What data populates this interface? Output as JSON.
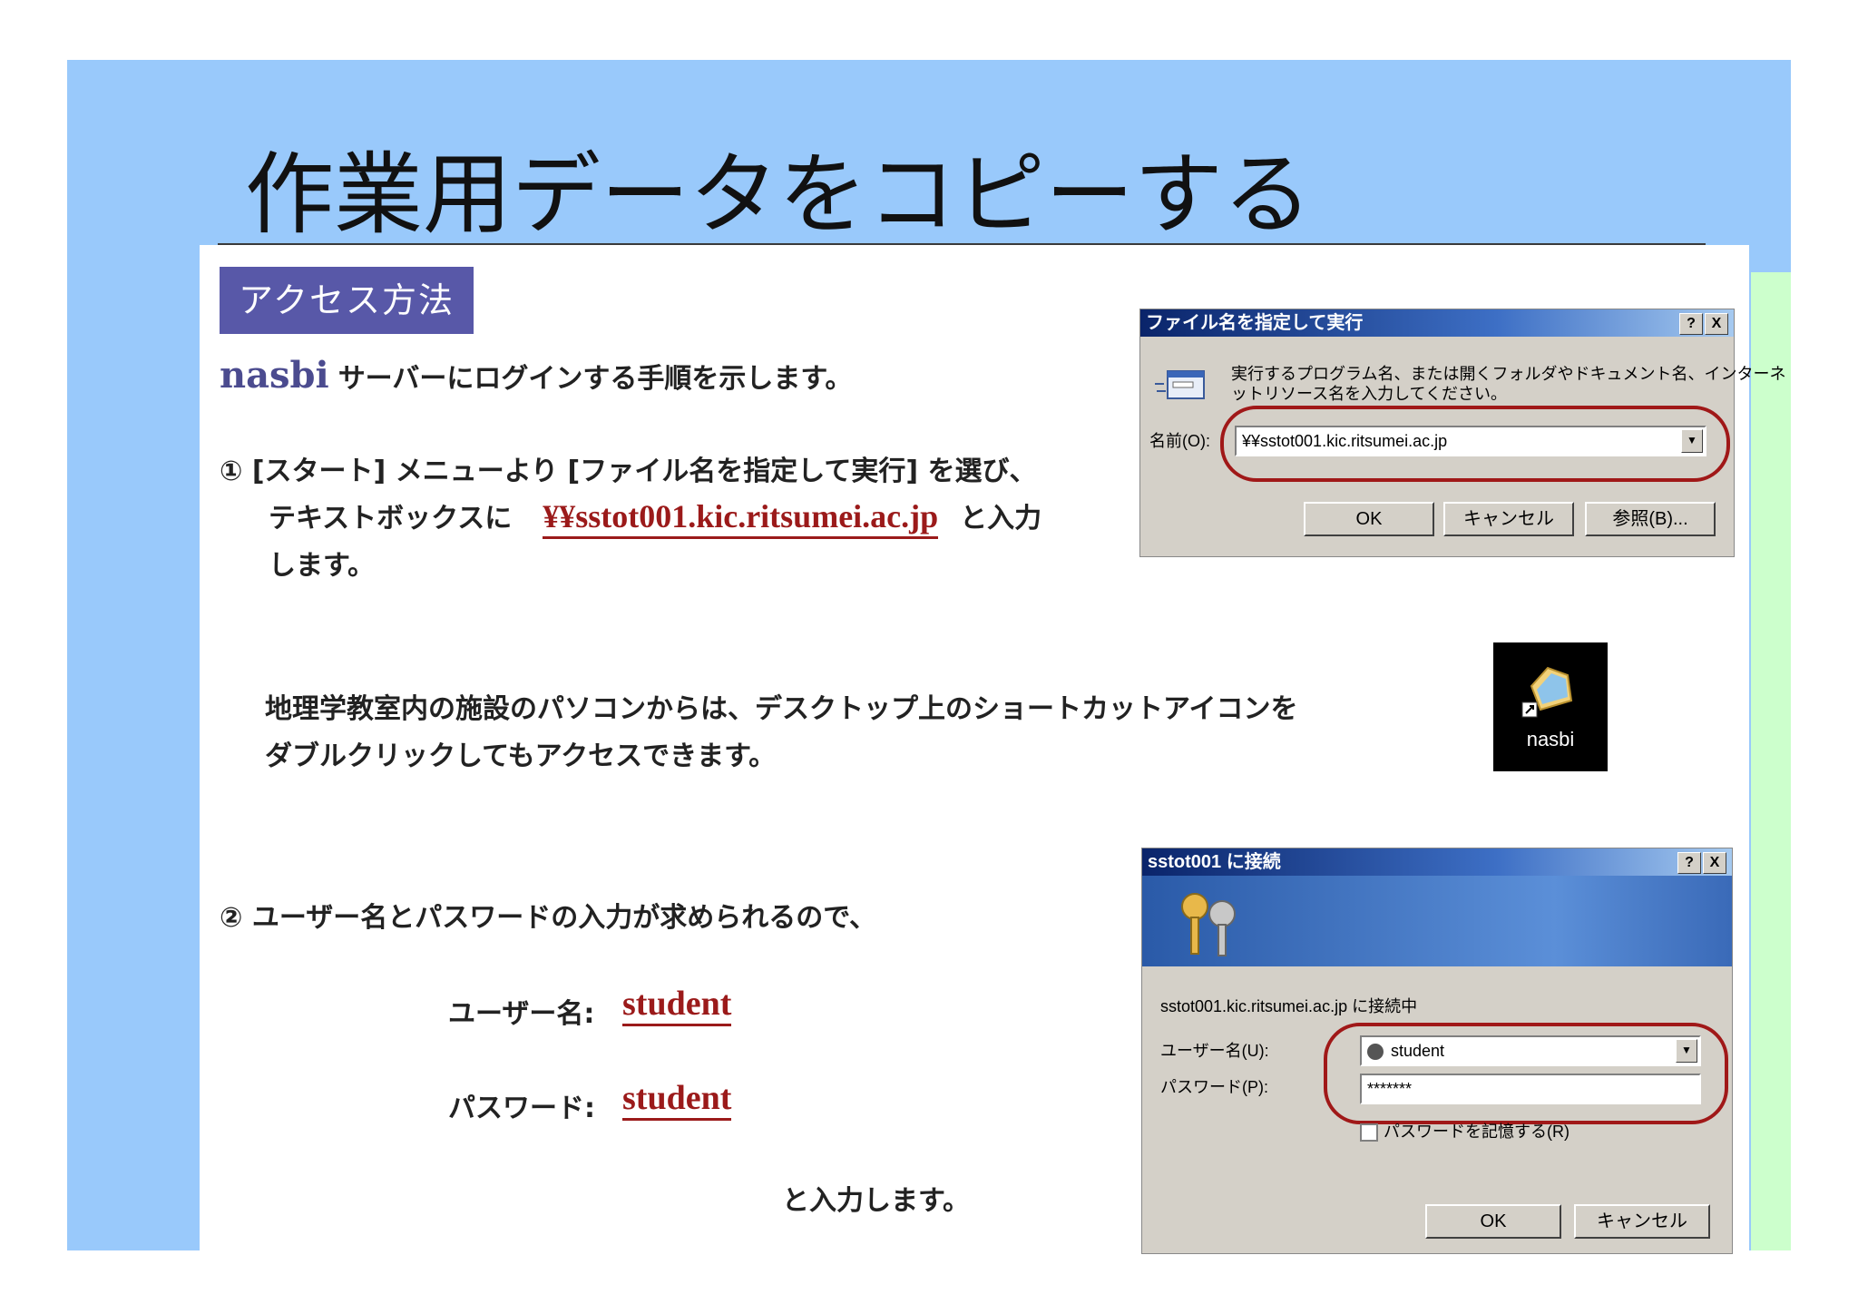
{
  "slide": {
    "title": "作業用データをコピーする",
    "section_badge": "アクセス方法"
  },
  "body": {
    "intro_server": "nasbi",
    "intro_text": "サーバーにログインする手順を示します。",
    "step1_line1": "① [スタート] メニューより [ファイル名を指定して実行] を選び、",
    "step1_line2_prefix": "テキストボックスに",
    "step1_path": "¥¥sstot001.kic.ritsumei.ac.jp",
    "step1_line2_suffix": "と入力",
    "step1_line3": "します。",
    "desktop_note_1": "地理学教室内の施設のパソコンからは、デスクトップ上のショートカットアイコンを",
    "desktop_note_2": "ダブルクリックしてもアクセスできます。",
    "step2": "② ユーザー名とパスワードの入力が求められるので、",
    "user_label": "ユーザー名:",
    "user_value": "student",
    "pass_label": "パスワード:",
    "pass_value": "student",
    "enter_note": "と入力します。"
  },
  "run_dialog": {
    "title": "ファイル名を指定して実行",
    "help": "?",
    "close": "X",
    "description_1": "実行するプログラム名、または開くフォルダやドキュメント名、インターネ",
    "description_2": "ットリソース名を入力してください。",
    "name_label": "名前(O):",
    "name_value": "¥¥sstot001.kic.ritsumei.ac.jp",
    "ok": "OK",
    "cancel": "キャンセル",
    "browse": "参照(B)..."
  },
  "shortcut": {
    "label": "nasbi",
    "icon": "network-folder-icon"
  },
  "connect_dialog": {
    "title": "sstot001 に接続",
    "help": "?",
    "close": "X",
    "connecting_text": "sstot001.kic.ritsumei.ac.jp に接続中",
    "user_label": "ユーザー名(U):",
    "user_value": "student",
    "pass_label": "パスワード(P):",
    "pass_value": "*******",
    "remember_label": "パスワードを記憶する(R)",
    "ok": "OK",
    "cancel": "キャンセル"
  }
}
